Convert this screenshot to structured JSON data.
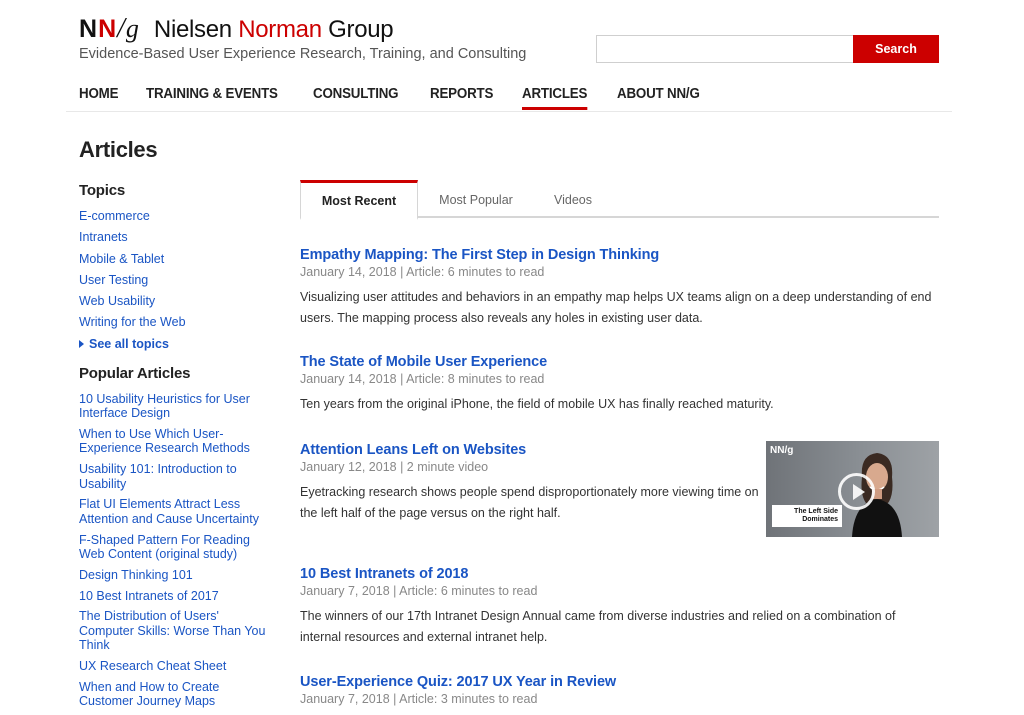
{
  "header": {
    "logo": {
      "n1": "N",
      "n2": "N",
      "slash": "/",
      "g": "g"
    },
    "brand_part1": "Nielsen ",
    "brand_accent": "Norman",
    "brand_part3": " Group",
    "tagline": "Evidence-Based User Experience Research, Training, and Consulting",
    "search_placeholder": "",
    "search_button": "Search"
  },
  "nav": {
    "items": [
      "HOME",
      "TRAINING & EVENTS",
      "CONSULTING",
      "REPORTS",
      "ARTICLES",
      "ABOUT NN/G"
    ],
    "active": "ARTICLES"
  },
  "page_title": "Articles",
  "sidebar": {
    "topics_heading": "Topics",
    "topics": [
      "E-commerce",
      "Intranets",
      "Mobile & Tablet",
      "User Testing",
      "Web Usability",
      "Writing for the Web"
    ],
    "see_all": "See all topics",
    "popular_heading": "Popular Articles",
    "popular": [
      "10 Usability Heuristics for User Interface Design",
      "When to Use Which User-Experience Research Methods",
      "Usability 101: Introduction to Usability",
      "Flat UI Elements Attract Less Attention and Cause Uncertainty",
      "F-Shaped Pattern For Reading Web Content (original study)",
      "Design Thinking 101",
      "10 Best Intranets of 2017",
      "The Distribution of Users' Computer Skills: Worse Than You Think",
      "UX Research Cheat Sheet",
      "When and How to Create Customer Journey Maps"
    ]
  },
  "tabs": [
    "Most Recent",
    "Most Popular",
    "Videos"
  ],
  "articles": [
    {
      "title": "Empathy Mapping: The First Step in Design Thinking",
      "meta": "January 14, 2018 | Article: 6 minutes to read",
      "desc": "Visualizing user attitudes and behaviors in an empathy map helps UX teams align on a deep understanding of end users. The mapping process also reveals any holes in existing user data."
    },
    {
      "title": "The State of Mobile User Experience",
      "meta": "January 14, 2018 | Article: 8 minutes to read",
      "desc": "Ten years from the original iPhone, the field of mobile UX has finally reached maturity."
    },
    {
      "title": "Attention Leans Left on Websites",
      "meta": "January 12, 2018 | 2 minute video",
      "desc": "Eyetracking research shows people spend disproportionately more viewing time on the left half of the page versus on the right half.",
      "video": {
        "logo": "NN/g",
        "caption_line1": "The Left Side",
        "caption_line2": "Dominates"
      }
    },
    {
      "title": "10 Best Intranets of 2018",
      "meta": "January 7, 2018 | Article: 6 minutes to read",
      "desc": "The winners of our 17th Intranet Design Annual came from diverse industries and relied on a combination of internal resources and external intranet help."
    },
    {
      "title": "User-Experience Quiz: 2017 UX Year in Review",
      "meta": "January 7, 2018 | Article: 3 minutes to read"
    }
  ],
  "colors": {
    "accent": "#cc0000",
    "link": "#1a55c4"
  }
}
